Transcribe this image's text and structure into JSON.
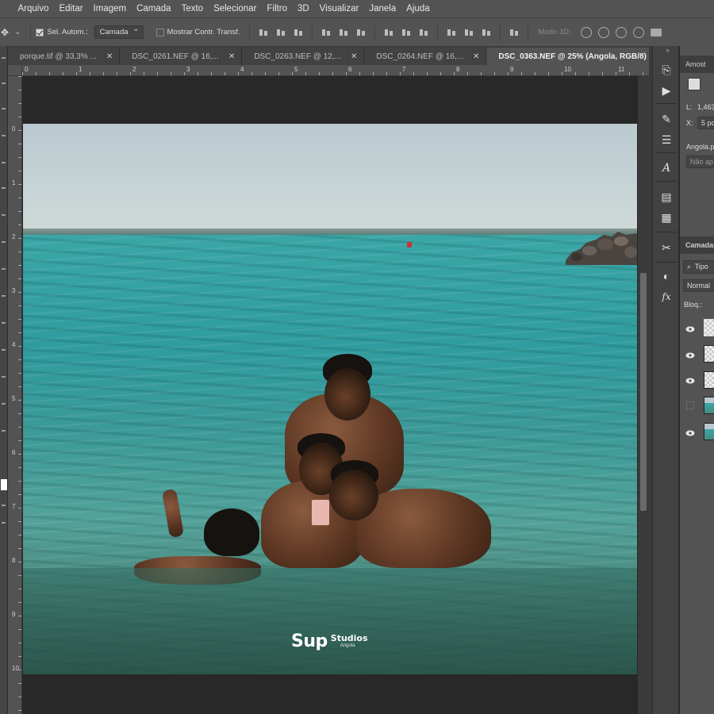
{
  "menu": {
    "items": [
      "Arquivo",
      "Editar",
      "Imagem",
      "Camada",
      "Texto",
      "Selecionar",
      "Filtro",
      "3D",
      "Visualizar",
      "Janela",
      "Ajuda"
    ]
  },
  "options": {
    "auto_select_label": "Sel. Autom.:",
    "auto_select_value": "Camada",
    "show_transform_label": "Mostrar Contr. Transf.",
    "mode_3d_label": "Modo 3D:"
  },
  "tabs": [
    {
      "label": "porque.tif @ 33,3% ...",
      "active": false
    },
    {
      "label": "DSC_0261.NEF @ 16,...",
      "active": false
    },
    {
      "label": "DSC_0263.NEF @ 12,...",
      "active": false
    },
    {
      "label": "DSC_0264.NEF @ 16,...",
      "active": false
    },
    {
      "label": "DSC_0363.NEF @ 25% (Angola, RGB/8) *",
      "active": true
    }
  ],
  "ruler": {
    "h_labels": [
      "0",
      "1",
      "2",
      "3",
      "4",
      "5",
      "6",
      "7",
      "8",
      "9",
      "10",
      "11"
    ],
    "v_labels": [
      "0",
      "1",
      "2",
      "3",
      "4",
      "5",
      "6",
      "7",
      "8",
      "9",
      "10"
    ]
  },
  "watermark": {
    "main": "Sup",
    "sub1": "Studios",
    "sub2": "Angola"
  },
  "right_panel": {
    "sample_tab": "Amost",
    "l_label": "L:",
    "l_value": "1,463",
    "x_label": "X:",
    "x_value": "5 po",
    "preset_name": "Angola.p",
    "preset_status": "Não ap",
    "layers_tab": "Camadas",
    "filter_kind": "Tipo",
    "blend_mode": "Normal",
    "lock_label": "Bloq.:"
  },
  "layers": [
    {
      "visible": true,
      "kind": "transparent"
    },
    {
      "visible": true,
      "kind": "transparent"
    },
    {
      "visible": true,
      "kind": "transparent"
    },
    {
      "visible": false,
      "kind": "photo"
    },
    {
      "visible": true,
      "kind": "photo"
    }
  ]
}
